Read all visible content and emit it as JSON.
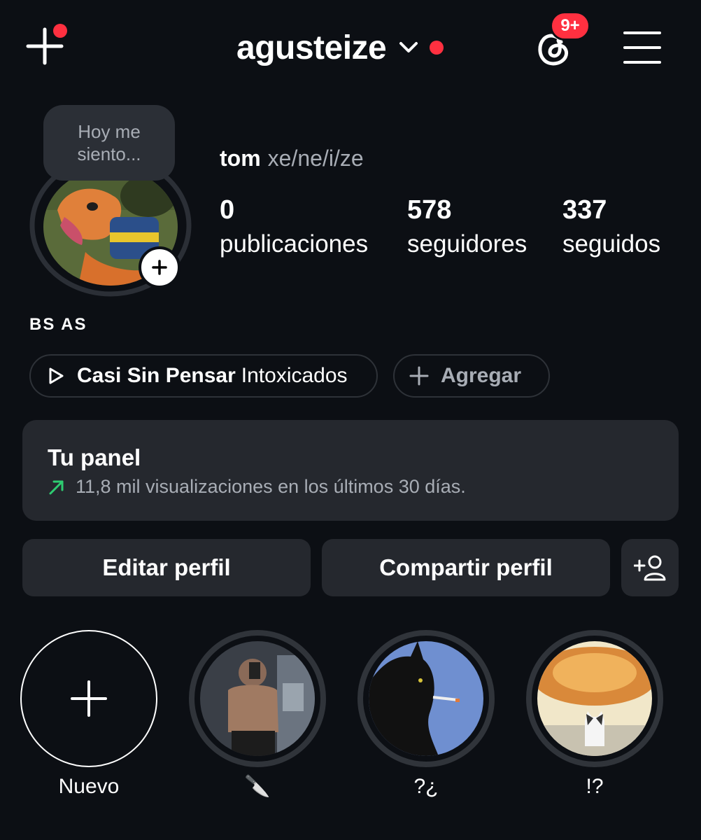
{
  "header": {
    "username": "agusteize",
    "notifications_badge": "9+",
    "accent_color": "#ff3040",
    "icons": [
      "create-plus-icon",
      "chevron-down-icon",
      "threads-icon",
      "hamburger-menu-icon"
    ]
  },
  "profile": {
    "note": "Hoy me siento...",
    "name": "tom",
    "pronouns": "xe/ne/i/ze",
    "location": "BS AS"
  },
  "stats": [
    {
      "value": "0",
      "label": "publicaciones"
    },
    {
      "value": "578",
      "label": "seguidores"
    },
    {
      "value": "337",
      "label": "seguidos"
    }
  ],
  "music": {
    "title": "Casi Sin Pensar",
    "artist": "Intoxicados"
  },
  "add_chip": {
    "label": "Agregar"
  },
  "panel": {
    "title": "Tu panel",
    "subtitle": "11,8 mil visualizaciones en los últimos 30 días.",
    "trend_color": "#2ecc71"
  },
  "buttons": {
    "edit": "Editar perfil",
    "share": "Compartir perfil"
  },
  "highlights": [
    {
      "label": "Nuevo"
    },
    {
      "label": "🔪"
    },
    {
      "label": "?¿"
    },
    {
      "label": "!?"
    }
  ]
}
